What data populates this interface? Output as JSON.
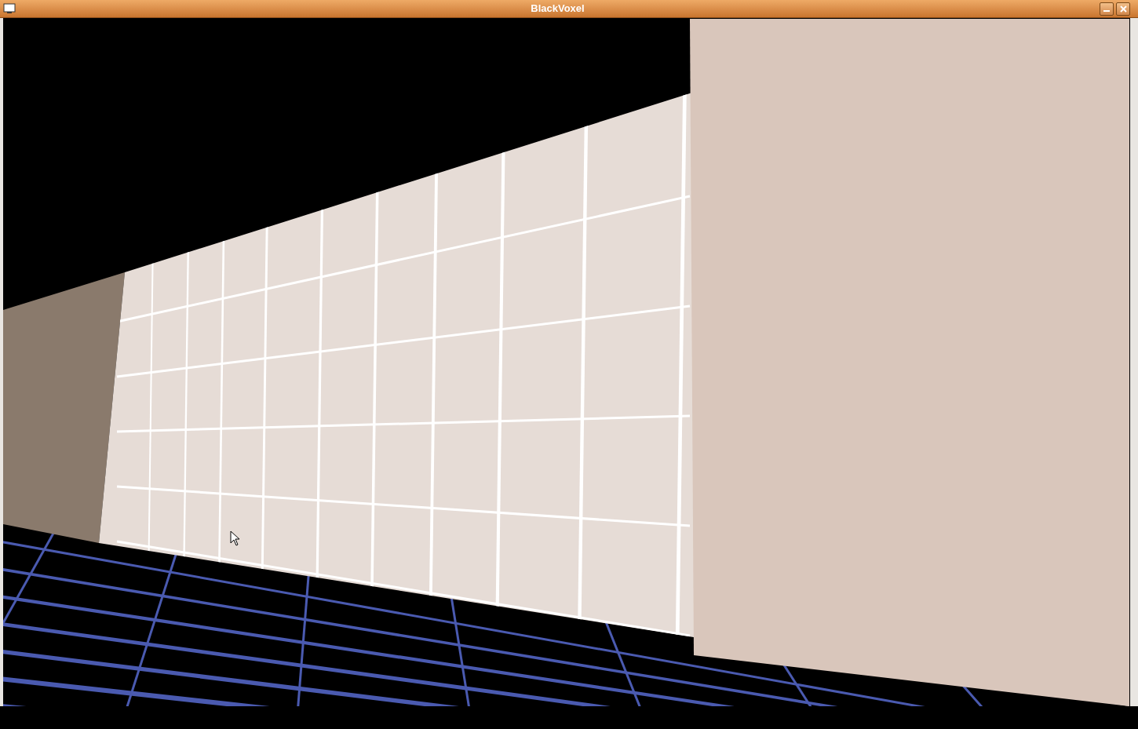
{
  "window": {
    "title": "BlackVoxel"
  }
}
